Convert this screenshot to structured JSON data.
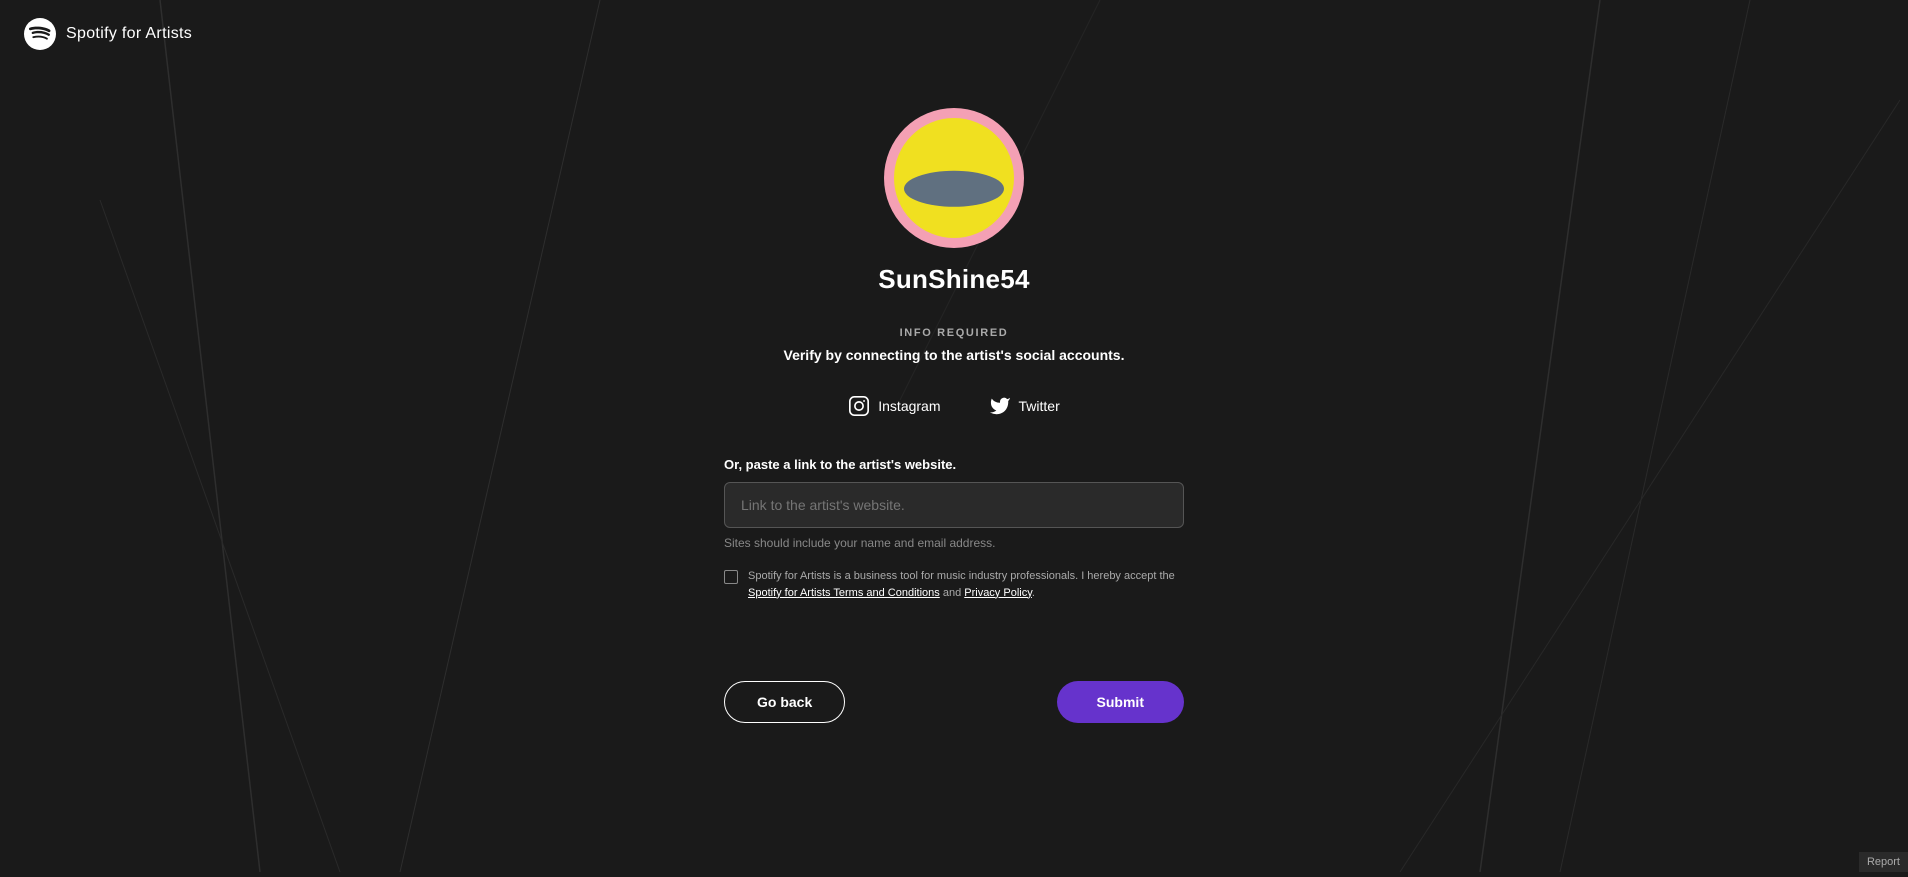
{
  "header": {
    "logo_alt": "Spotify for Artists",
    "logo_text_bold": "Spotify",
    "logo_text_light": " for Artists"
  },
  "artist": {
    "name": "SunShine54"
  },
  "info_section": {
    "required_label": "INFO REQUIRED",
    "subtitle": "Verify by connecting to the artist's social accounts."
  },
  "social": {
    "instagram_label": "Instagram",
    "twitter_label": "Twitter"
  },
  "website": {
    "label": "Or, paste a link to the artist's website.",
    "placeholder": "Link to the artist's website.",
    "hint": "Sites should include your name and email address."
  },
  "terms": {
    "text_prefix": "Spotify for Artists is a business tool for music industry professionals. I hereby accept the ",
    "link1": "Spotify for Artists Terms and Conditions",
    "text_middle": " and ",
    "link2": "Privacy Policy",
    "text_suffix": "."
  },
  "buttons": {
    "go_back": "Go back",
    "submit": "Submit"
  },
  "report": "Report"
}
